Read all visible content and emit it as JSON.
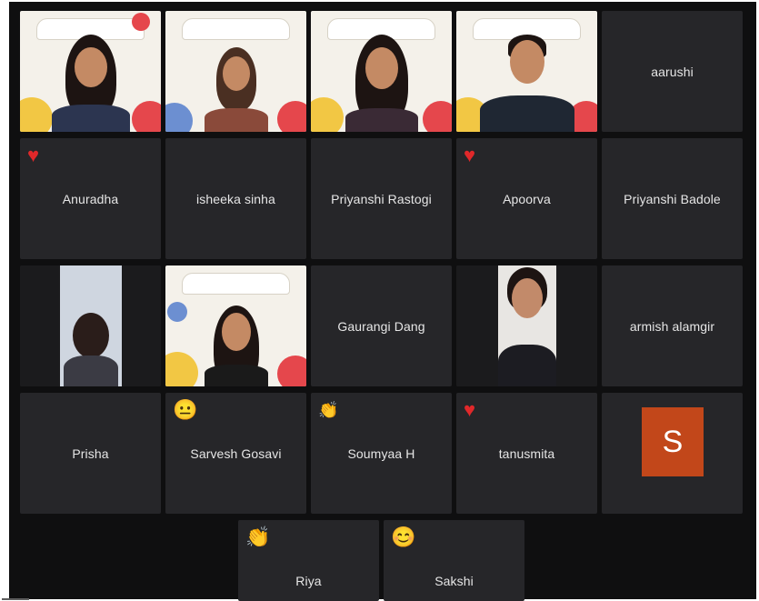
{
  "participants": {
    "p1": {
      "name": "",
      "has_video": true
    },
    "p2": {
      "name": "",
      "has_video": true
    },
    "p3": {
      "name": "",
      "has_video": true
    },
    "p4": {
      "name": "",
      "has_video": true
    },
    "aarushi": {
      "name": "aarushi"
    },
    "anuradha": {
      "name": "Anuradha",
      "reaction": "♥"
    },
    "isheeka": {
      "name": "isheeka sinha"
    },
    "priyanshi_r": {
      "name": "Priyanshi Rastogi"
    },
    "apoorva": {
      "name": "Apoorva",
      "reaction": "♥"
    },
    "priyanshi_b": {
      "name": "Priyanshi Badole"
    },
    "gaurangi": {
      "name": "Gaurangi Dang"
    },
    "armish": {
      "name": "armish alamgir"
    },
    "prisha": {
      "name": "Prisha"
    },
    "sarvesh": {
      "name": "Sarvesh Gosavi",
      "reaction": "😐"
    },
    "soumyaa": {
      "name": "Soumyaa H",
      "reaction": "👏"
    },
    "tanusmita": {
      "name": "tanusmita",
      "reaction": "♥"
    },
    "s_avatar": {
      "initial": "S"
    },
    "riya": {
      "name": "Riya",
      "reaction": "👏"
    },
    "sakshi": {
      "name": "Sakshi",
      "reaction": "😊"
    }
  },
  "colors": {
    "stage": "#0f0f10",
    "tile": "#262629",
    "active_outline": "#2ea043",
    "heart": "#e0282a",
    "avatar_bg": "#c2471a"
  },
  "icons": [
    "heart-icon",
    "neutral-face-emoji-icon",
    "clap-emoji-icon",
    "smile-emoji-icon"
  ]
}
